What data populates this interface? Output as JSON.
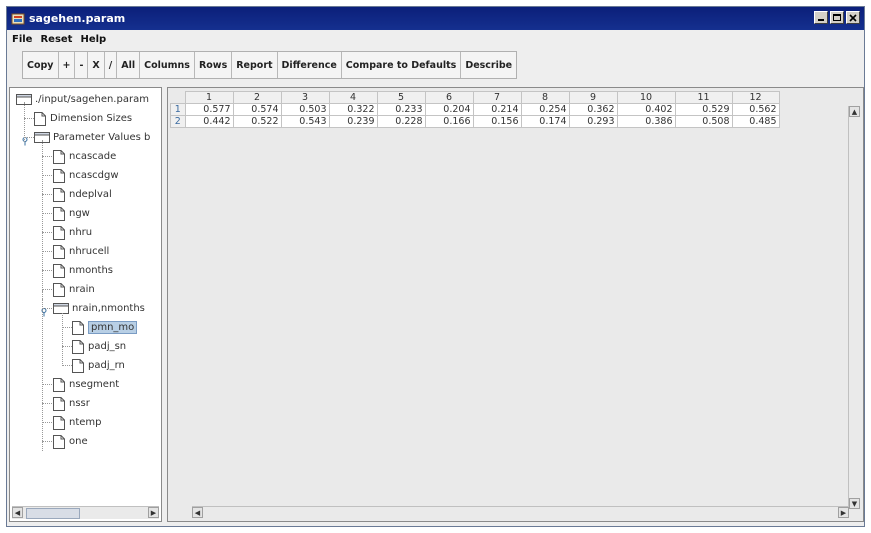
{
  "window": {
    "title": "sagehen.param"
  },
  "menu": [
    "File",
    "Reset",
    "Help"
  ],
  "toolbar": {
    "group1": [
      "Copy",
      "+",
      "-",
      "X",
      "/",
      "All"
    ],
    "group2": [
      "Columns",
      "Rows",
      "Report",
      "Difference",
      "Compare to Defaults",
      "Describe"
    ]
  },
  "tree": {
    "root": "./input/sagehen.param",
    "dimension": "Dimension Sizes",
    "param_values": "Parameter Values b",
    "items": [
      "ncascade",
      "ncascdgw",
      "ndeplval",
      "ngw",
      "nhru",
      "nhrucell",
      "nmonths",
      "nrain"
    ],
    "expanded": "nrain,nmonths",
    "children": [
      "pmn_mo",
      "padj_sn",
      "padj_rn"
    ],
    "after": [
      "nsegment",
      "nssr",
      "ntemp",
      "one"
    ]
  },
  "table": {
    "columns": [
      "1",
      "2",
      "3",
      "4",
      "5",
      "6",
      "7",
      "8",
      "9",
      "10",
      "11",
      "12"
    ],
    "rows": [
      {
        "label": "1",
        "values": [
          "0.577",
          "0.574",
          "0.503",
          "0.322",
          "0.233",
          "0.204",
          "0.214",
          "0.254",
          "0.362",
          "0.402",
          "0.529",
          "0.562"
        ]
      },
      {
        "label": "2",
        "values": [
          "0.442",
          "0.522",
          "0.543",
          "0.239",
          "0.228",
          "0.166",
          "0.156",
          "0.174",
          "0.293",
          "0.386",
          "0.508",
          "0.485"
        ]
      }
    ]
  },
  "colors": {
    "titlebar": "#0b1f7a",
    "selection": "#b8cfe5"
  }
}
